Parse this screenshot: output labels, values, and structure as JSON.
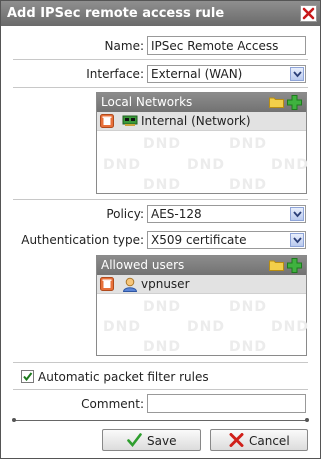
{
  "dialog": {
    "title": "Add IPSec remote access rule"
  },
  "name": {
    "label": "Name:",
    "value": "IPSec Remote Access"
  },
  "interface": {
    "label": "Interface:",
    "selected": "External (WAN)"
  },
  "local_networks": {
    "title": "Local Networks",
    "items": [
      {
        "label": "Internal (Network)",
        "icon": "network-card-icon"
      }
    ],
    "watermark": "DND"
  },
  "policy": {
    "label": "Policy:",
    "selected": "AES-128"
  },
  "auth_type": {
    "label": "Authentication type:",
    "selected": "X509 certificate"
  },
  "allowed_users": {
    "title": "Allowed users",
    "items": [
      {
        "label": "vpnuser",
        "icon": "user-icon"
      }
    ],
    "watermark": "DND"
  },
  "auto_packet_filter": {
    "label": "Automatic packet filter rules",
    "checked": true
  },
  "comment": {
    "label": "Comment:",
    "value": ""
  },
  "buttons": {
    "save": "Save",
    "cancel": "Cancel"
  },
  "colors": {
    "titlebar": "#7a7a7a",
    "panel_header": "#808080",
    "save_check": "#2e9e2e",
    "cancel_x": "#d0201a"
  }
}
